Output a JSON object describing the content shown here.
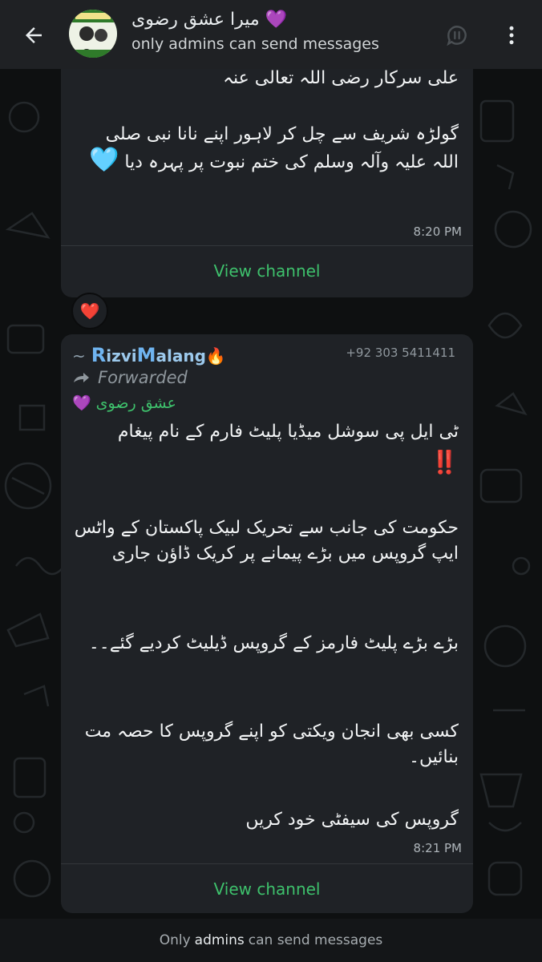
{
  "header": {
    "title": "میرا عشق رضوی",
    "title_emoji": "💜",
    "subtitle": "only admins can send messages",
    "back_icon": "arrow-left-icon",
    "call_icon": "voice-chat-icon",
    "menu_icon": "more-vertical-icon"
  },
  "messages": [
    {
      "partial_line": "علی سرکار رضی اللہ تعالی عنہ",
      "text": "گولڑہ شریف سے چل کر لاہور اپنے نانا نبی صلی اللہ علیہ وآلہ وسلم کی ختم نبوت پر پہرہ دیا",
      "emoji": "🩵",
      "time": "8:20 PM",
      "action_label": "View channel",
      "reaction": "❤️"
    },
    {
      "sender_prefix": "~",
      "sender_name_part1": "R",
      "sender_name_part2": "izvi",
      "sender_name_part3": "M",
      "sender_name_part4": "alang",
      "sender_emoji": "🔥",
      "sender_phone": "+92 303 5411411",
      "forwarded_label": "Forwarded",
      "channel_emoji": "💜",
      "channel_name": "عشق رضوی",
      "heading": "ٹی ایل پی سوشل میڈیا پلیٹ فارم کے نام پیغام",
      "heading_emoji": "‼️",
      "para1": "حکومت کی جانب سے تحریک لبیک پاکستان کے واٹس ایپ گروپس میں بڑے پیمانے پر کریک ڈاؤن جاری",
      "para2": "بڑے بڑے پلیٹ فارمز کے گروپس ڈیلیٹ کردیے گئے۔۔",
      "para3": "کسی بھی انجان ویکتی کو اپنے گروپس کا حصہ مت بنائیں۔",
      "para4": "گروپس کی سیفٹی خود کریں",
      "time": "8:21 PM",
      "action_label": "View channel"
    }
  ],
  "footer": {
    "prefix": "Only",
    "bold": "admins",
    "suffix": "can send messages"
  },
  "colors": {
    "accent": "#3ec16c",
    "bubble": "#1f2226",
    "header": "#1f2124"
  }
}
